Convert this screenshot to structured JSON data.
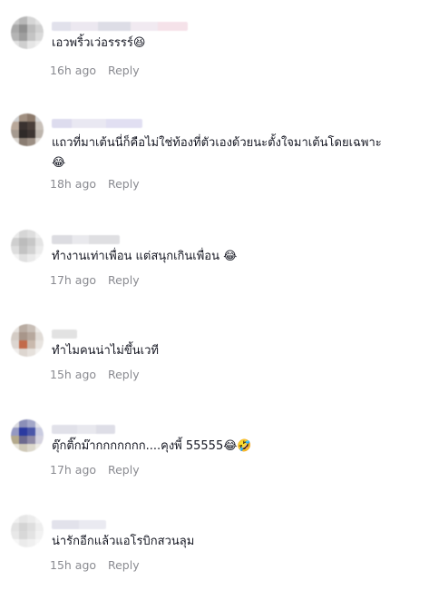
{
  "comments": [
    {
      "text": "เอวพริ้วเว่อรรรร์",
      "emoji": "😆",
      "time": "16h ago",
      "reply": "Reply"
    },
    {
      "text": "แถวที่มาเต้นนี่ก็คือไม่ใช่ท้องที่ตัวเองด้วยนะตั้งใจมาเต้นโดยเฉพาะ",
      "emoji": "😂",
      "time": "18h ago",
      "reply": "Reply"
    },
    {
      "text": "ทำงานเท่าเพื่อน แต่สนุกเกินเพื่อน",
      "emoji": "😂",
      "time": "17h ago",
      "reply": "Reply"
    },
    {
      "text": "ทำไมคนน่าไม่ขึ้นเวที",
      "emoji": "",
      "time": "15h ago",
      "reply": "Reply"
    },
    {
      "text": "ตุ๊กติ๊กม๊ากกกกกกก....คุงพี้ 55555",
      "emoji": "😂🤣",
      "time": "17h ago",
      "reply": "Reply"
    },
    {
      "text": "น่ารักอีกแล้วแอโรบิกสวนลุม",
      "emoji": "",
      "time": "15h ago",
      "reply": "Reply"
    }
  ]
}
